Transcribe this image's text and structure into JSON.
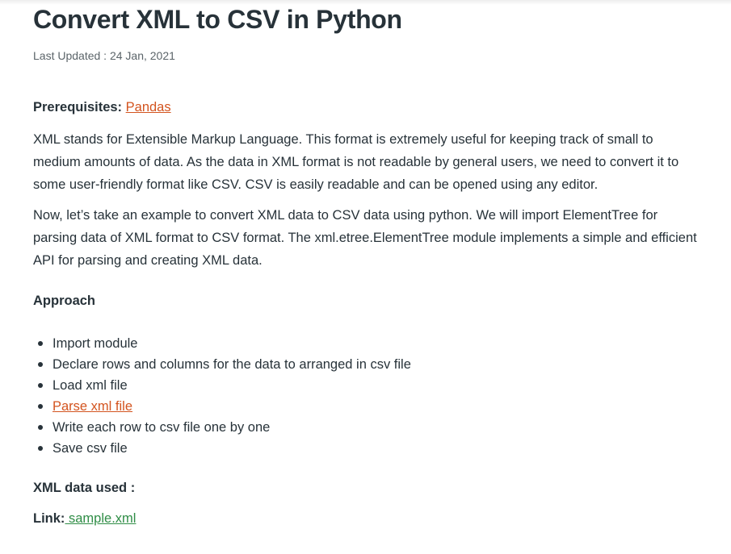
{
  "article": {
    "title": "Convert XML to CSV in Python",
    "last_updated": "Last Updated : 24 Jan, 2021",
    "prerequisites_label": "Prerequisites:",
    "prerequisites_link": "Pandas",
    "paragraph1": "XML stands for Extensible Markup Language. This format is extremely useful for keeping track of small to medium amounts of data. As the data in XML format is not readable by general users, we need to convert it to some user-friendly format like CSV. CSV is easily readable and can be opened using any editor.",
    "paragraph2": "Now, let’s take an example to convert XML data to CSV data using python. We will import ElementTree for parsing data of XML format to CSV format. The xml.etree.ElementTree module implements a simple and efficient API for parsing and creating XML data.",
    "approach_heading": "Approach",
    "steps": [
      {
        "text": "Import module",
        "is_link": false
      },
      {
        "text": "Declare rows and columns for the data to arranged in csv file",
        "is_link": false
      },
      {
        "text": "Load xml file",
        "is_link": false
      },
      {
        "text": "Parse xml file",
        "is_link": true
      },
      {
        "text": "Write each row to csv file one by one",
        "is_link": false
      },
      {
        "text": "Save csv file",
        "is_link": false
      }
    ],
    "xml_data_heading": "XML data used :",
    "link_label": "Link:",
    "link_text": " sample.xml"
  },
  "colors": {
    "text": "#273239",
    "muted": "#5b6469",
    "link_orange": "#d3541f",
    "link_green": "#2f8d46"
  }
}
